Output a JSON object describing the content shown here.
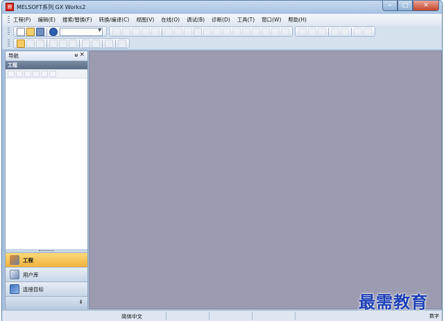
{
  "window": {
    "title": "MELSOFT系列 GX Works2"
  },
  "menu": [
    "工程(P)",
    "编辑(E)",
    "搜索/替换(F)",
    "转换/编译(C)",
    "视图(V)",
    "在线(O)",
    "调试(B)",
    "诊断(D)",
    "工具(T)",
    "窗口(W)",
    "帮助(H)"
  ],
  "navigation": {
    "header": "导航",
    "pin_glyph": "ᵾ",
    "close_glyph": "×",
    "section_title": "工程",
    "tabs": [
      {
        "label": "工程",
        "icon": "project-icon",
        "active": true
      },
      {
        "label": "用户库",
        "icon": "library-icon",
        "active": false
      },
      {
        "label": "连接目标",
        "icon": "connection-icon",
        "active": false
      }
    ],
    "expand_glyph": "⇟"
  },
  "statusbar": {
    "language": "简体中文",
    "right_text": "数字"
  },
  "watermark": "最需教育",
  "colors": {
    "workspace": "#9b9bb2",
    "titlebar": "#a8c3e2",
    "active_tab": "#f1b23d"
  }
}
